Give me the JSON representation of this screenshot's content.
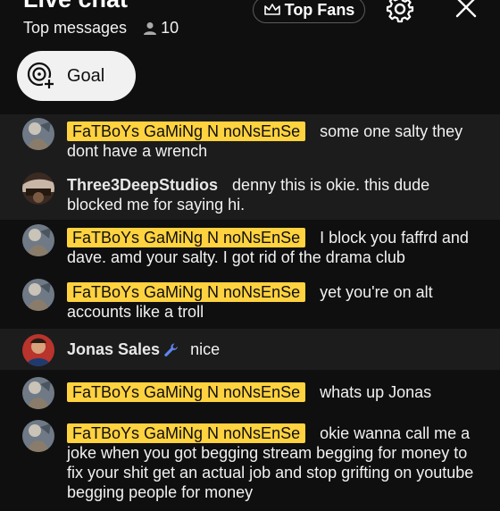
{
  "header": {
    "title": "Live chat",
    "mode": "Top messages",
    "viewer_count": "10",
    "top_fans_label": "Top Fans",
    "goal_label": "Goal"
  },
  "colors": {
    "background": "#0f0f0f",
    "row_alt": "#1c1c1c",
    "owner_badge": "#ffd240",
    "moderator_icon": "#5e84f1"
  },
  "messages": [
    {
      "author": "FaTBoYs GaMiNg N noNsEnSe",
      "text": "some one salty they dont have a wrench"
    },
    {
      "author": "Three3DeepStudios",
      "text": "denny this is okie. this dude blocked me for saying hi."
    },
    {
      "author": "FaTBoYs GaMiNg N noNsEnSe",
      "text": "I block you faffrd and dave. amd your salty. I got rid of the drama club"
    },
    {
      "author": "FaTBoYs GaMiNg N noNsEnSe",
      "text": "yet you're on alt accounts like a troll"
    },
    {
      "author": "Jonas Sales",
      "text": "nice"
    },
    {
      "author": "FaTBoYs GaMiNg N noNsEnSe",
      "text": "whats up Jonas"
    },
    {
      "author": "FaTBoYs GaMiNg N noNsEnSe",
      "text": "okie wanna call me a joke when you got begging stream begging for money to fix your shit get an actual job and stop grifting on youtube begging people for money"
    }
  ]
}
